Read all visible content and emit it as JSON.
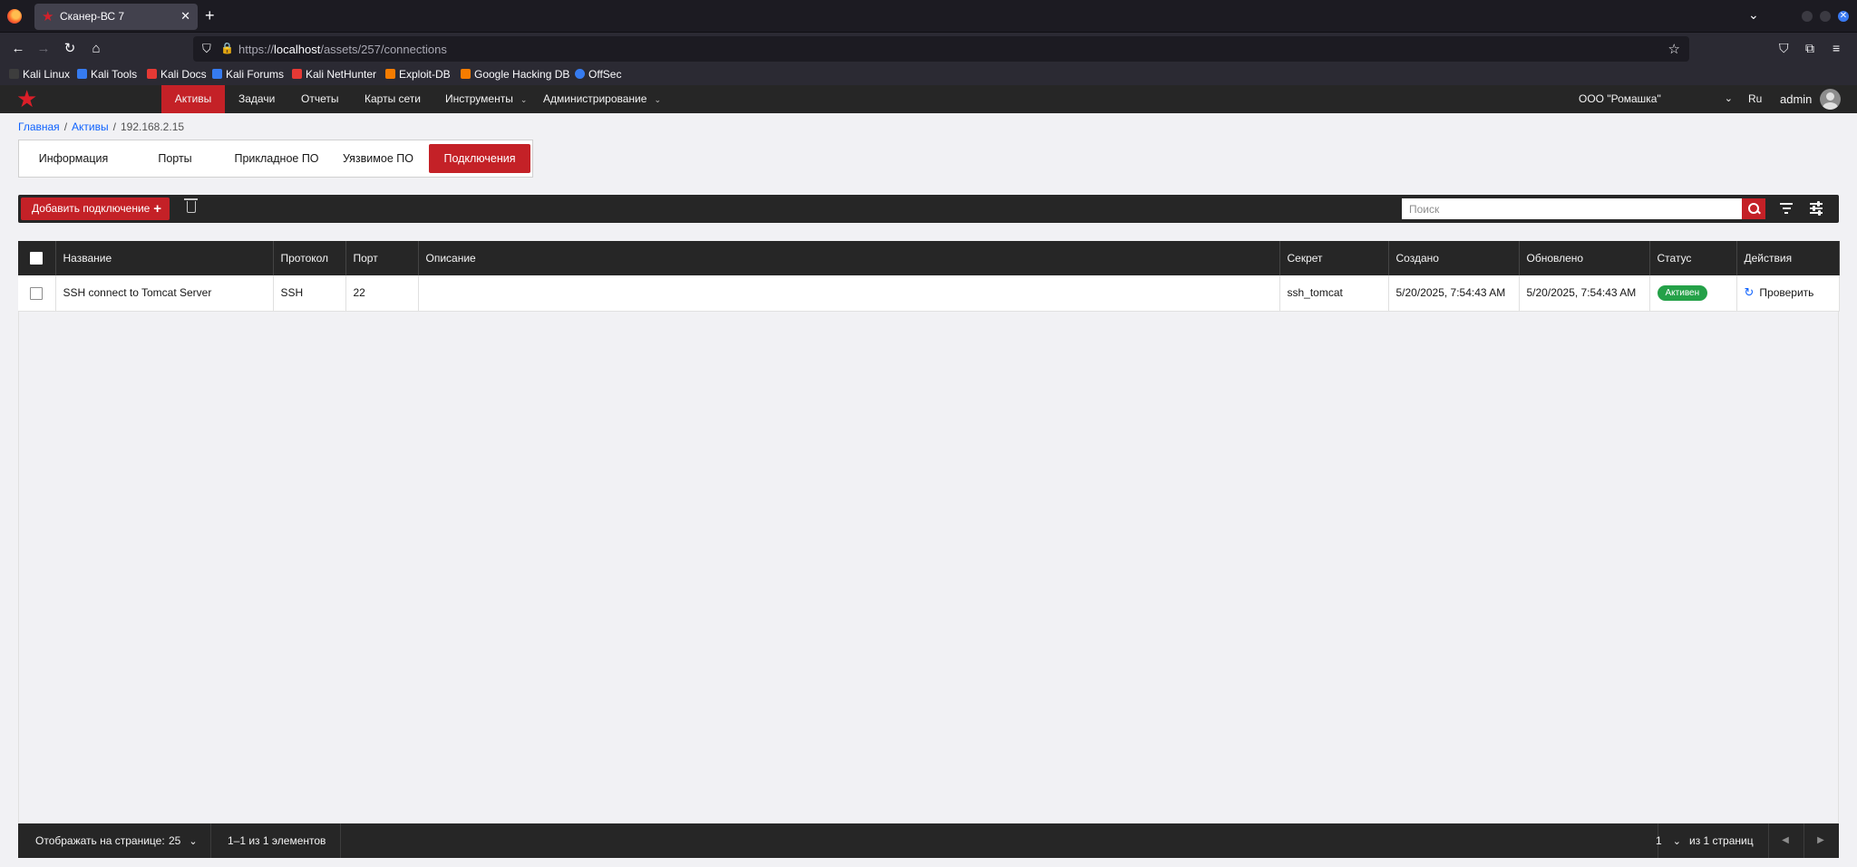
{
  "browser": {
    "tab_title": "Сканер-ВС 7",
    "url_prefix": "https://",
    "url_host": "localhost",
    "url_path": "/assets/257/connections",
    "bookmarks": [
      "Kali Linux",
      "Kali Tools",
      "Kali Docs",
      "Kali Forums",
      "Kali NetHunter",
      "Exploit-DB",
      "Google Hacking DB",
      "OffSec"
    ]
  },
  "header": {
    "menu": [
      "Активы",
      "Задачи",
      "Отчеты",
      "Карты сети",
      "Инструменты",
      "Администрирование"
    ],
    "organization": "ООО \"Ромашка\"",
    "language": "Ru",
    "user": "admin"
  },
  "breadcrumb": {
    "home": "Главная",
    "assets": "Активы",
    "current": "192.168.2.15"
  },
  "tabs": [
    "Информация",
    "Порты",
    "Прикладное ПО",
    "Уязвимое ПО",
    "Подключения"
  ],
  "toolbar": {
    "add_label": "Добавить подключение",
    "search_placeholder": "Поиск"
  },
  "table": {
    "columns": [
      "Название",
      "Протокол",
      "Порт",
      "Описание",
      "Секрет",
      "Создано",
      "Обновлено",
      "Статус",
      "Действия"
    ],
    "rows": [
      {
        "name": "SSH connect to Tomcat Server",
        "protocol": "SSH",
        "port": "22",
        "description": "",
        "secret": "ssh_tomcat",
        "created": "5/20/2025, 7:54:43 AM",
        "updated": "5/20/2025, 7:54:43 AM",
        "status": "Активен",
        "action": "Проверить"
      }
    ]
  },
  "pagination": {
    "per_page_label": "Отображать на странице:",
    "per_page_value": "25",
    "range_text": "1–1 из 1 элементов",
    "page_value": "1",
    "page_total_text": "из 1 страниц"
  },
  "colors": {
    "brand": "#c42127",
    "status_active": "#24a148",
    "link": "#0f62fe"
  }
}
